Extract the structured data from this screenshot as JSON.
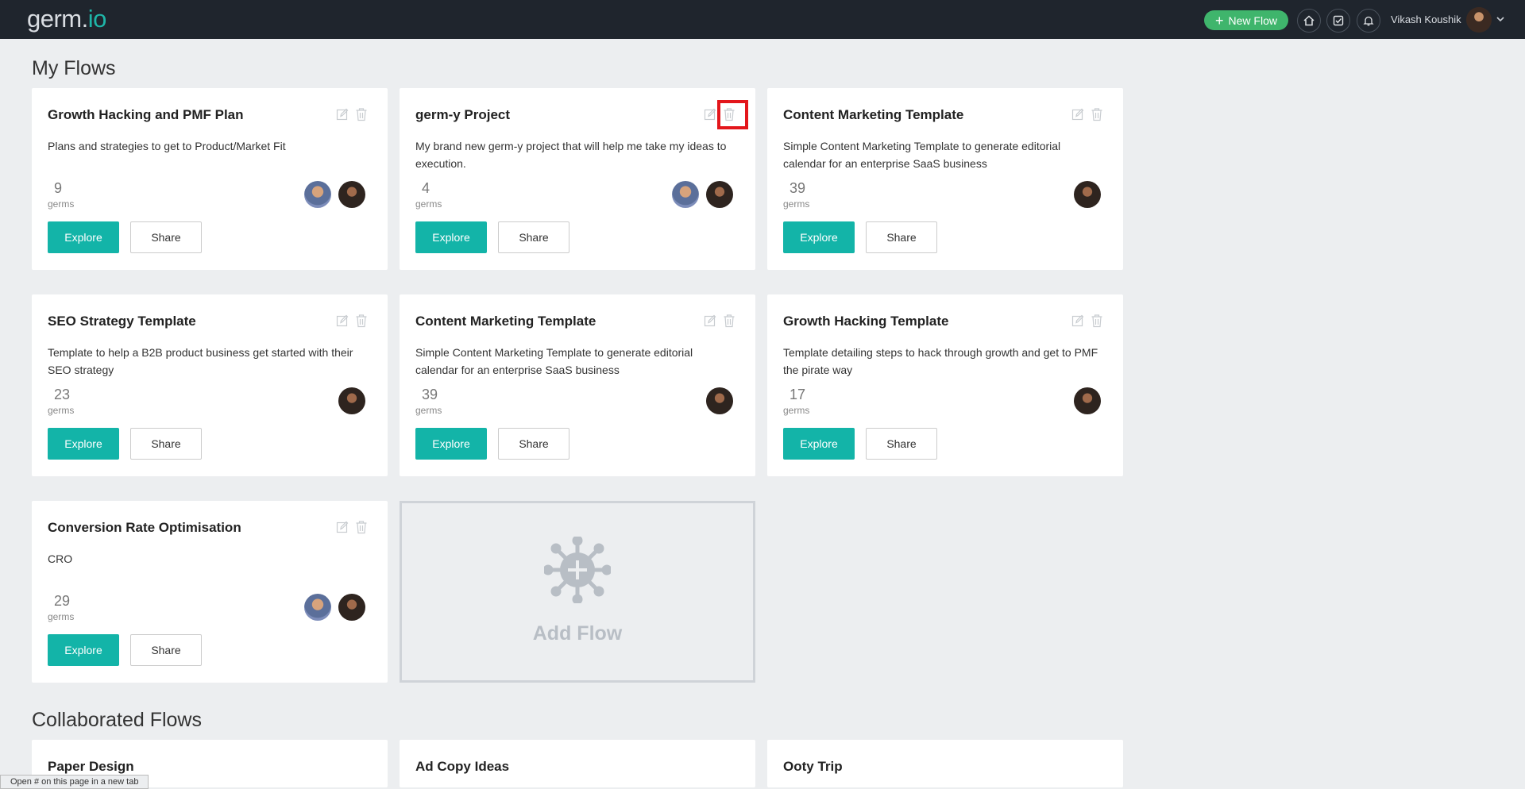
{
  "header": {
    "logo": {
      "main": "germ.",
      "accent": "io"
    },
    "new_flow_label": "New Flow",
    "nav_icons": [
      "home-icon",
      "checklist-icon",
      "bell-icon"
    ],
    "user_name": "Vikash Koushik"
  },
  "sections": {
    "my_flows_title": "My Flows",
    "collab_title": "Collaborated Flows"
  },
  "my_flows": [
    {
      "title": "Growth Hacking and PMF Plan",
      "desc": "Plans and strategies to get to Product/Market Fit",
      "count": "9",
      "count_label": "germs",
      "explore": "Explore",
      "share": "Share"
    },
    {
      "title": "germ-y Project",
      "desc": "My brand new germ-y project that will help me take my ideas to execution.",
      "count": "4",
      "count_label": "germs",
      "explore": "Explore",
      "share": "Share"
    },
    {
      "title": "Content Marketing Template",
      "desc": "Simple Content Marketing Template to generate editorial calendar for an enterprise SaaS business",
      "count": "39",
      "count_label": "germs",
      "explore": "Explore",
      "share": "Share"
    },
    {
      "title": "SEO Strategy Template",
      "desc": "Template to help a B2B product business get started with their SEO strategy",
      "count": "23",
      "count_label": "germs",
      "explore": "Explore",
      "share": "Share"
    },
    {
      "title": "Content Marketing Template",
      "desc": "Simple Content Marketing Template to generate editorial calendar for an enterprise SaaS business",
      "count": "39",
      "count_label": "germs",
      "explore": "Explore",
      "share": "Share"
    },
    {
      "title": "Growth Hacking Template",
      "desc": "Template detailing steps to hack through growth and get to PMF the pirate way",
      "count": "17",
      "count_label": "germs",
      "explore": "Explore",
      "share": "Share"
    },
    {
      "title": "Conversion Rate Optimisation",
      "desc": "CRO",
      "count": "29",
      "count_label": "germs",
      "explore": "Explore",
      "share": "Share"
    }
  ],
  "add_flow_label": "Add Flow",
  "collab_flows": [
    {
      "title": "Paper Design"
    },
    {
      "title": "Ad Copy Ideas"
    },
    {
      "title": "Ooty Trip"
    }
  ],
  "status_bar": "Open # on this page in a new tab",
  "colors": {
    "topbar": "#1f252d",
    "accent": "#13b4a8",
    "new_flow": "#3fb56c",
    "highlight": "#e3161b"
  }
}
